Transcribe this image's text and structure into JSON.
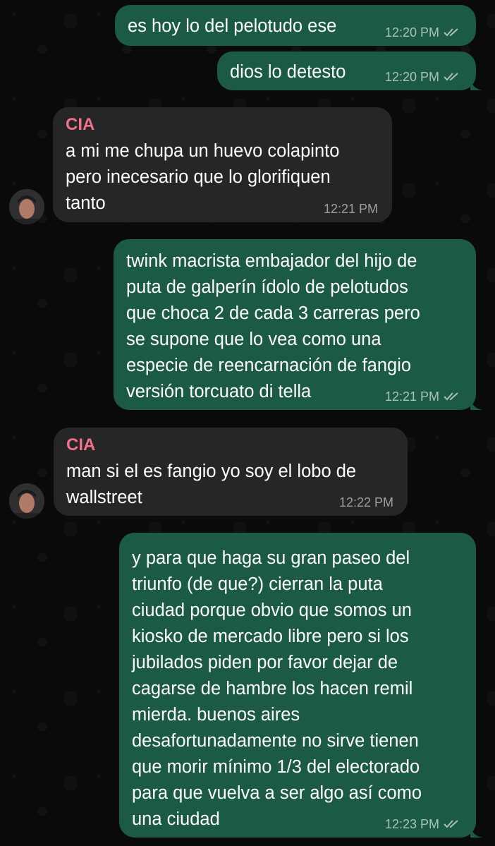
{
  "messages": [
    {
      "text": "es hoy lo del pelotudo ese",
      "time": "12:20 PM"
    },
    {
      "text": "dios lo detesto",
      "time": "12:20 PM"
    },
    {
      "sender": "CIA",
      "text": "a mi me chupa un huevo colapinto\npero inecesario que lo glorifiquen\ntanto",
      "time": "12:21 PM"
    },
    {
      "text": "twink macrista embajador del hijo de\nputa de galperín ídolo de pelotudos\nque choca 2 de cada 3 carreras pero\nse supone que lo vea como una\nespecie de reencarnación de fangio\nversión torcuato di tella",
      "time": "12:21 PM"
    },
    {
      "sender": "CIA",
      "text": "man si el es fangio yo soy el lobo de\nwallstreet",
      "time": "12:22 PM"
    },
    {
      "text": "y para que haga su gran paseo del\ntriunfo (de que?) cierran la puta\nciudad porque obvio que somos un\nkiosko de mercado libre pero si los\njubilados piden por favor dejar de\ncagarse de hambre los hacen remil\nmierda. buenos aires\ndesafortunadamente no sirve tienen\nque morir mínimo 1/3 del electorado\npara que vuelva a ser algo así como\nuna ciudad",
      "time": "12:23 PM"
    }
  ],
  "colors": {
    "outgoing_bubble": "#1b5a45",
    "incoming_bubble": "#262626",
    "sender_name": "#f07189",
    "background": "#0a0a0a"
  },
  "icons": {
    "read_receipt": "double-check-icon",
    "avatar": "contact-avatar"
  }
}
